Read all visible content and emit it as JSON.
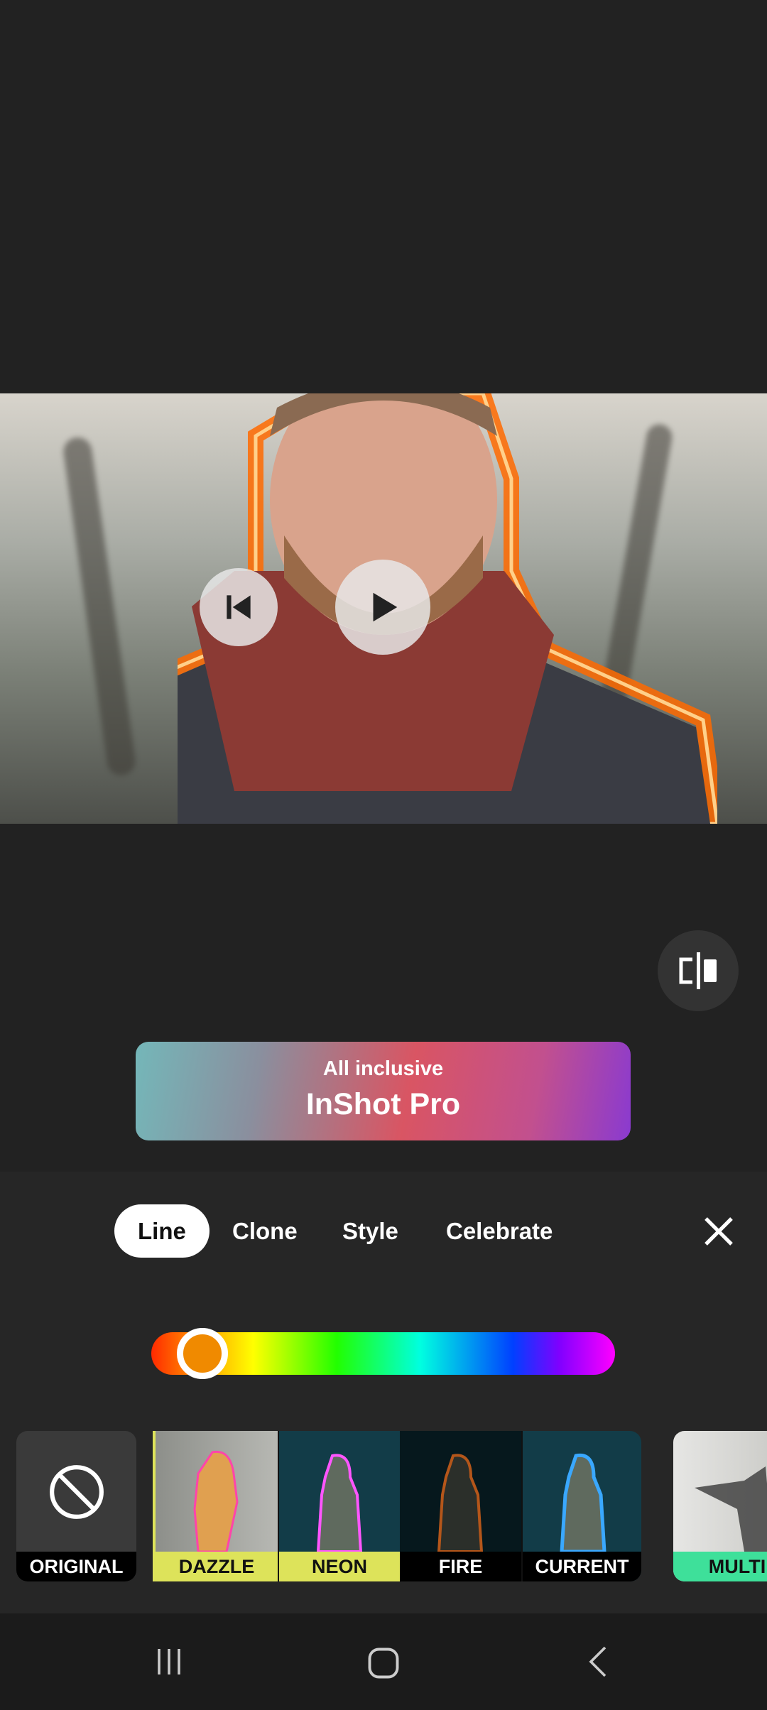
{
  "player": {
    "prev_icon": "skip-previous-icon",
    "play_icon": "play-icon"
  },
  "compare": {
    "icon": "compare-split-icon"
  },
  "banner": {
    "subtitle": "All inclusive",
    "title": "InShot Pro"
  },
  "tabs": [
    {
      "label": "Line",
      "active": true
    },
    {
      "label": "Clone"
    },
    {
      "label": "Style"
    },
    {
      "label": "Celebrate"
    }
  ],
  "close_icon": "close-icon",
  "color_slider": {
    "selected_color": "#f08a00",
    "position_percent": 11
  },
  "effects": [
    {
      "label": "ORIGINAL",
      "icon": "none-icon"
    },
    {
      "label": "DAZZLE",
      "label_bg": "#dde35a"
    },
    {
      "label": "NEON",
      "label_bg": "#dde35a"
    },
    {
      "label": "FIRE",
      "label_bg": "#000000"
    },
    {
      "label": "CURRENT",
      "label_bg": "#000000"
    },
    {
      "label": "MULTI",
      "label_bg": "#3ee09a"
    }
  ],
  "navbar": {
    "recents_icon": "recents-icon",
    "home_icon": "home-icon",
    "back_icon": "back-icon"
  }
}
